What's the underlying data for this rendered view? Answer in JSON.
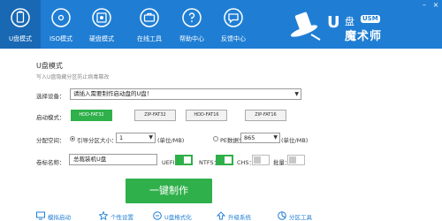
{
  "window": {
    "minimize_label": "–",
    "close_label": "×"
  },
  "nav": {
    "items": [
      {
        "label": "U盘模式",
        "icon": "usb-drive-icon"
      },
      {
        "label": "ISO模式",
        "icon": "disc-icon"
      },
      {
        "label": "硬盘模式",
        "icon": "hard-disk-icon"
      },
      {
        "label": "在线工具",
        "icon": "toolbox-icon"
      },
      {
        "label": "帮助中心",
        "icon": "question-icon"
      },
      {
        "label": "反馈中心",
        "icon": "feedback-icon"
      }
    ]
  },
  "brand": {
    "u": "U",
    "top": "盘",
    "badge": "USM",
    "main": "魔术师"
  },
  "page": {
    "title": "U盘模式",
    "subtitle": "写入U盘隐藏分区防止病毒篡改"
  },
  "device": {
    "label": "选择设备：",
    "value": "请插入需要制作启动盘的U盘！"
  },
  "boot_mode": {
    "label": "启动模式：",
    "options": [
      "HDD-FAT32",
      "ZIP-FAT32",
      "HDD-FAT16",
      "ZIP-FAT16"
    ],
    "selected": "HDD-FAT32"
  },
  "partition": {
    "label": "分配空间：",
    "boot_label": "引导分区大小：",
    "boot_value": "1",
    "boot_unit": "(单位/MB)",
    "pe_label": "PE数据分区大小：",
    "pe_value": "865",
    "pe_unit": "(单位/MB)"
  },
  "volume": {
    "label": "卷标名称：",
    "value": "总裁装机U盘"
  },
  "options": {
    "uefi_label": "UEFI：",
    "uefi_on": true,
    "ntfs_label": "NTFS：",
    "ntfs_on": true,
    "chs_label": "CHS：",
    "chs_on": false,
    "batch_label": "批量：",
    "batch_on": false
  },
  "actions": {
    "make_label": "一键制作"
  },
  "bottom": {
    "items": [
      {
        "label": "模拟启动",
        "icon": "monitor-icon"
      },
      {
        "label": "个性设置",
        "icon": "star-icon"
      },
      {
        "label": "U盘格式化",
        "icon": "format-icon"
      },
      {
        "label": "升级系统",
        "icon": "upgrade-icon"
      },
      {
        "label": "分区工具",
        "icon": "partition-icon"
      }
    ]
  },
  "colors": {
    "brand_blue": "#1f7ed4",
    "active_green": "#2fb04a"
  }
}
